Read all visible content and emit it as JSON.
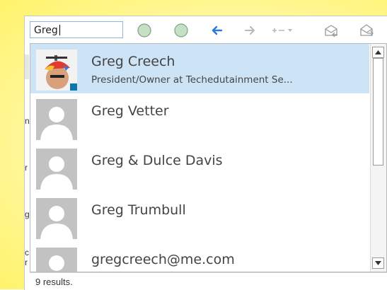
{
  "search": {
    "value": "Greg"
  },
  "toolbar": {
    "icons": [
      "circle-icon",
      "circle-icon",
      "back-arrow-icon",
      "forward-arrow-icon",
      "dash-dropdown-icon",
      "envelope-reply-icon",
      "envelope-open-icon"
    ],
    "accent": "#2b79d0"
  },
  "results": [
    {
      "name": "Greg Creech",
      "subtitle": "President/Owner at Techedutainment Se...",
      "selected": true,
      "avatar": "photo"
    },
    {
      "name": "Greg Vetter",
      "subtitle": "",
      "selected": false,
      "avatar": "placeholder"
    },
    {
      "name": "Greg & Dulce Davis",
      "subtitle": "",
      "selected": false,
      "avatar": "placeholder"
    },
    {
      "name": "Greg Trumbull",
      "subtitle": "",
      "selected": false,
      "avatar": "placeholder"
    },
    {
      "name": "gregcreech@me.com",
      "subtitle": "",
      "selected": false,
      "avatar": "placeholder"
    }
  ],
  "status": {
    "text": "9 results."
  },
  "edge_fragments": [
    "n",
    "r",
    "g",
    "c",
    "r"
  ],
  "colors": {
    "selected_bg": "#cde4f7",
    "highlight": "#fff36a",
    "placeholder_avatar": "#c2c2c2",
    "linkedin_badge": "#0e76a8"
  }
}
